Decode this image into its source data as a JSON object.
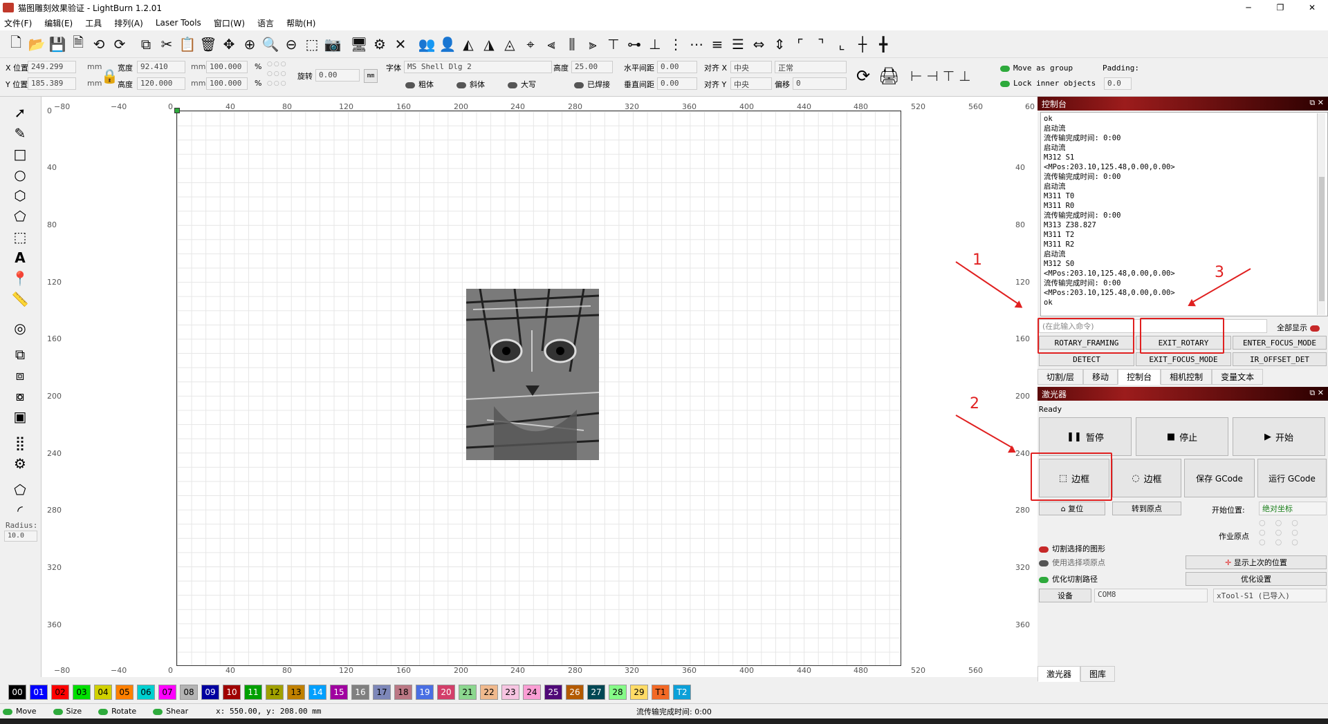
{
  "window": {
    "title": "猫图雕刻效果验证 - LightBurn 1.2.01",
    "minimize": "─",
    "maximize": "❐",
    "close": "✕"
  },
  "menu": [
    "文件(F)",
    "编辑(E)",
    "工具",
    "排列(A)",
    "Laser Tools",
    "窗口(W)",
    "语言",
    "帮助(H)"
  ],
  "props": {
    "x_label": "X 位置",
    "x_value": "249.299",
    "y_label": "Y 位置",
    "y_value": "185.389",
    "unit": "mm",
    "pct": "%",
    "w_label": "宽度",
    "w_value": "92.410",
    "h_label": "高度",
    "h_value": "120.000",
    "w_pct": "100.000",
    "h_pct": "100.000",
    "rotate_label": "旋转",
    "rotate_value": "0.00",
    "mm_button": "mm",
    "font_label": "字体",
    "font_value": "MS Shell Dlg 2",
    "height_label": "高度",
    "height_value": "25.00",
    "hspace_label": "水平间距",
    "hspace_value": "0.00",
    "vspace_label": "垂直间距",
    "vspace_value": "0.00",
    "alignx_label": "对齐 X",
    "alignx_value": "中央",
    "aligny_label": "对齐 Y",
    "aligny_value": "中央",
    "style_value": "正常",
    "offset_label": "偏移",
    "offset_value": "0",
    "bold": "粗体",
    "italic": "斜体",
    "upper": "大写",
    "welded": "已焊接",
    "move_group": "Move as group",
    "lock_inner": "Lock inner objects",
    "padding_label": "Padding:",
    "padding_value": "0.0"
  },
  "ruler": {
    "top": [
      "−80",
      "−40",
      "0",
      "40",
      "80",
      "120",
      "160",
      "200",
      "240",
      "280",
      "320",
      "360",
      "400",
      "440",
      "480",
      "520",
      "560",
      "60"
    ],
    "left": [
      "0",
      "40",
      "80",
      "120",
      "160",
      "200",
      "240",
      "280",
      "320",
      "360"
    ],
    "right": [
      "40",
      "80",
      "120",
      "160",
      "200",
      "240",
      "280",
      "320",
      "360"
    ]
  },
  "left_tools": {
    "radius_label": "Radius:",
    "radius_value": "10.0"
  },
  "console": {
    "title": "控制台",
    "lines": [
      "ok",
      "启动流",
      "流传输完成时间: 0:00",
      "启动流",
      "M312 S1",
      "<MPos:203.10,125.48,0.00,0.00>",
      "流传输完成时间: 0:00",
      "启动流",
      "M311 T0",
      "M311 R0",
      "流传输完成时间: 0:00",
      "M313 Z38.827",
      "M311 T2",
      "M311 R2",
      "启动流",
      "M312 S0",
      "<MPos:203.10,125.48,0.00,0.00>",
      "流传输完成时间: 0:00",
      "<MPos:203.10,125.48,0.00,0.00>",
      "ok"
    ],
    "command_placeholder": "(在此输入命令)",
    "show_all": "全部显示",
    "macros": [
      "ROTARY_FRAMING",
      "EXIT_ROTARY",
      "ENTER_FOCUS_MODE",
      "DETECT",
      "EXIT_FOCUS_MODE",
      "IR_OFFSET_DET"
    ],
    "tabs": [
      "切割/层",
      "移动",
      "控制台",
      "相机控制",
      "变量文本"
    ]
  },
  "laser": {
    "title": "激光器",
    "status": "Ready",
    "pause": "暂停",
    "stop": "停止",
    "start": "开始",
    "frame1": "边框",
    "frame2": "边框",
    "save_gcode": "保存 GCode",
    "run_gcode": "运行 GCode",
    "home": "复位",
    "goto_origin": "转到原点",
    "start_from_label": "开始位置:",
    "start_from_value": "绝对坐标",
    "job_origin": "作业原点",
    "cut_selected": "切割选择的图形",
    "use_selection_origin": "使用选择项原点",
    "optimize_path": "优化切割路径",
    "show_last_position": "显示上次的位置",
    "optimize_settings": "优化设置",
    "devices": "设备",
    "port": "COM8",
    "device": "xTool-S1 (已导入)",
    "tabs": [
      "激光器",
      "图库"
    ]
  },
  "annotations": [
    "1",
    "2",
    "3"
  ],
  "palette": [
    {
      "label": "00",
      "color": "#000000",
      "fg": "#ffffff"
    },
    {
      "label": "01",
      "color": "#0000ff",
      "fg": "#ffffff"
    },
    {
      "label": "02",
      "color": "#ff0000",
      "fg": "#000000"
    },
    {
      "label": "03",
      "color": "#00e000",
      "fg": "#000000"
    },
    {
      "label": "04",
      "color": "#d0d000",
      "fg": "#000000"
    },
    {
      "label": "05",
      "color": "#ff8000",
      "fg": "#000000"
    },
    {
      "label": "06",
      "color": "#00d0d0",
      "fg": "#000000"
    },
    {
      "label": "07",
      "color": "#ff00ff",
      "fg": "#000000"
    },
    {
      "label": "08",
      "color": "#b4b4b4",
      "fg": "#000000"
    },
    {
      "label": "09",
      "color": "#0000a0",
      "fg": "#ffffff"
    },
    {
      "label": "10",
      "color": "#a00000",
      "fg": "#ffffff"
    },
    {
      "label": "11",
      "color": "#00a000",
      "fg": "#ffffff"
    },
    {
      "label": "12",
      "color": "#a0a000",
      "fg": "#000000"
    },
    {
      "label": "13",
      "color": "#c08000",
      "fg": "#000000"
    },
    {
      "label": "14",
      "color": "#00a0ff",
      "fg": "#ffffff"
    },
    {
      "label": "15",
      "color": "#a000a0",
      "fg": "#ffffff"
    },
    {
      "label": "16",
      "color": "#808080",
      "fg": "#ffffff"
    },
    {
      "label": "17",
      "color": "#7d87b9",
      "fg": "#000000"
    },
    {
      "label": "18",
      "color": "#bb7784",
      "fg": "#000000"
    },
    {
      "label": "19",
      "color": "#4a6fe3",
      "fg": "#ffffff"
    },
    {
      "label": "20",
      "color": "#d33f6a",
      "fg": "#ffffff"
    },
    {
      "label": "21",
      "color": "#8cd78f",
      "fg": "#000000"
    },
    {
      "label": "22",
      "color": "#f0b98d",
      "fg": "#000000"
    },
    {
      "label": "23",
      "color": "#f6c4e1",
      "fg": "#000000"
    },
    {
      "label": "24",
      "color": "#fa9ed4",
      "fg": "#000000"
    },
    {
      "label": "25",
      "color": "#500a78",
      "fg": "#ffffff"
    },
    {
      "label": "26",
      "color": "#b45a00",
      "fg": "#ffffff"
    },
    {
      "label": "27",
      "color": "#004754",
      "fg": "#ffffff"
    },
    {
      "label": "28",
      "color": "#86fa88",
      "fg": "#000000"
    },
    {
      "label": "29",
      "color": "#ffdb66",
      "fg": "#000000"
    },
    {
      "label": "T1",
      "color": "#f36926",
      "fg": "#000000"
    },
    {
      "label": "T2",
      "color": "#0ca0d8",
      "fg": "#ffffff"
    }
  ],
  "status": {
    "move": "Move",
    "size": "Size",
    "rotate": "Rotate",
    "shear": "Shear",
    "coords": "x: 550.00, y: 208.00 mm",
    "stream": "流传输完成时间: 0:00"
  }
}
